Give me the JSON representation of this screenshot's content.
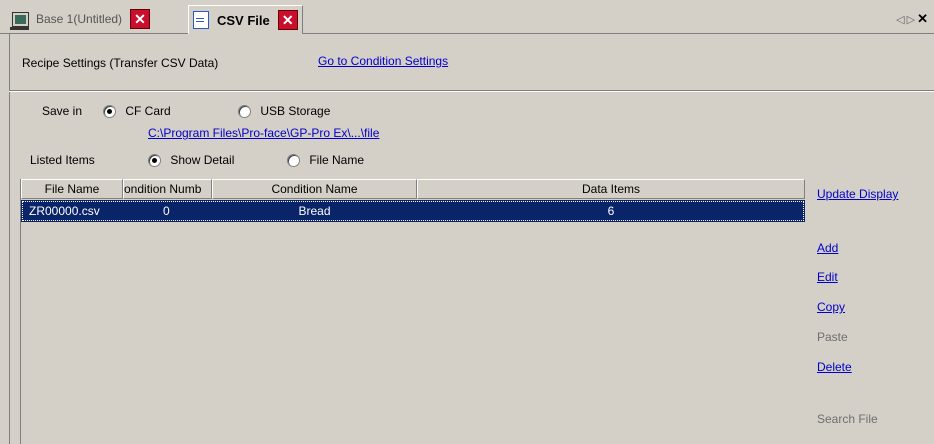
{
  "tabs": [
    {
      "label": "Base 1(Untitled)",
      "icon": "base-screen-icon",
      "active": false
    },
    {
      "label": "CSV File",
      "icon": "csv-file-icon",
      "active": true
    }
  ],
  "close_glyph": "✕",
  "tab_nav": {
    "left": "◁",
    "right": "▷",
    "close": "✕"
  },
  "header": {
    "title": "Recipe Settings (Transfer CSV Data)",
    "goto_link": "Go to Condition Settings"
  },
  "save_in": {
    "label": "Save in",
    "options": [
      "CF Card",
      "USB Storage"
    ],
    "selected": "CF Card",
    "path": "C:\\Program Files\\Pro-face\\GP-Pro Ex\\...\\file"
  },
  "listed_items": {
    "label": "Listed Items",
    "options": [
      "Show Detail",
      "File Name"
    ],
    "selected": "Show Detail"
  },
  "table": {
    "columns": [
      "File Name",
      "ondition Numb",
      "Condition Name",
      "Data Items"
    ],
    "rows": [
      {
        "file_name": "ZR00000.csv",
        "condition_number": "0",
        "condition_name": "Bread",
        "data_items": "6"
      }
    ]
  },
  "actions": {
    "update_display": "Update Display",
    "add": "Add",
    "edit": "Edit",
    "copy": "Copy",
    "paste": "Paste",
    "delete": "Delete",
    "search_file": "Search File"
  },
  "colors": {
    "selection": "#0a246a",
    "link": "#0000cc",
    "close": "#c8102e",
    "panel": "#d4d0c8"
  }
}
